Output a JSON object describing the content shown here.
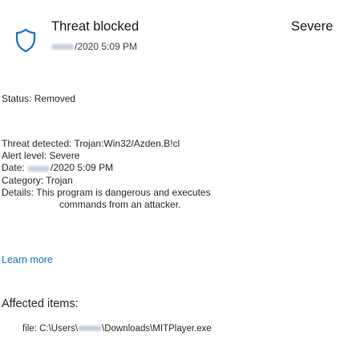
{
  "header": {
    "title": "Threat blocked",
    "severity": "Severe",
    "timestamp_suffix": "/2020 5:09 PM",
    "icon": "shield-icon"
  },
  "status": {
    "text": "Status: Removed"
  },
  "details": {
    "threat_detected": "Threat detected: Trojan:Win32/Azden.B!cl",
    "alert_level": "Alert level: Severe",
    "date_prefix": "Date: ",
    "date_suffix": "/2020 5:09 PM",
    "category": "Category: Trojan",
    "details_line1": "Details: This program is dangerous and executes",
    "details_line2": "commands from an attacker."
  },
  "learn_more": "Learn more",
  "affected": {
    "heading": "Affected items:",
    "file_prefix": "file: C:\\Users\\",
    "file_suffix": "\\Downloads\\MITPlayer.exe"
  },
  "colors": {
    "link": "#1a73c8",
    "shield_stroke": "#1a73c8",
    "text": "#2a2a2a"
  }
}
